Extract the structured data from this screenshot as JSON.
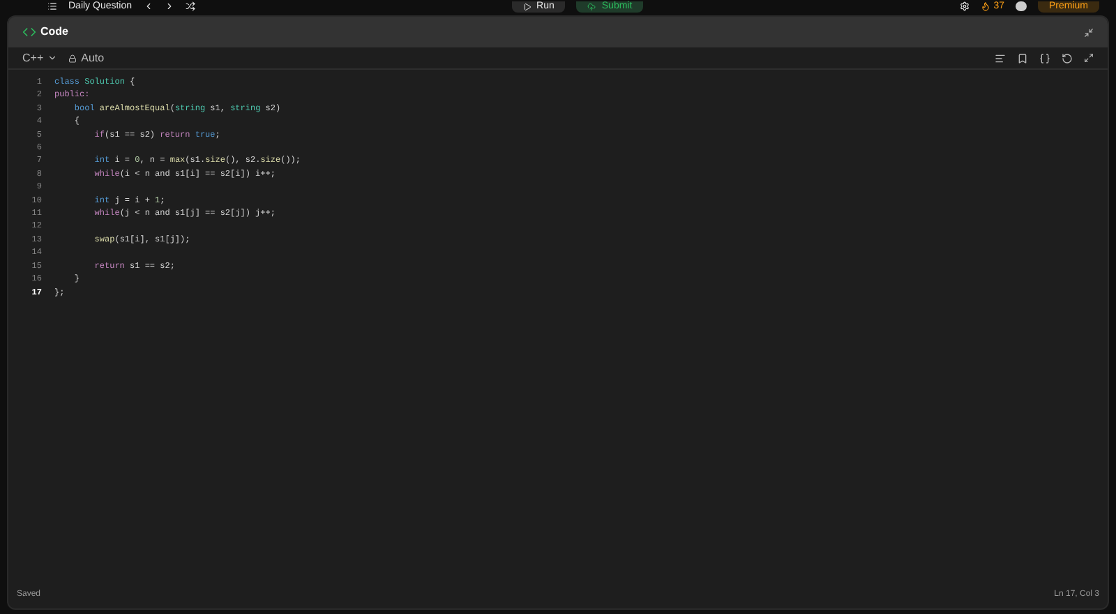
{
  "top_bar": {
    "title": "Daily Question",
    "run": "Run",
    "submit": "Submit",
    "streak": "37",
    "premium": "Premium"
  },
  "panel": {
    "title": "Code"
  },
  "toolbar": {
    "language": "C++",
    "mode": "Auto"
  },
  "editor": {
    "lines": [
      {
        "number": "1",
        "active": false,
        "tokens": [
          {
            "kind": "kw",
            "text": "class "
          },
          {
            "kind": "type",
            "text": "Solution"
          },
          {
            "kind": "plain",
            "text": " {"
          }
        ]
      },
      {
        "number": "2",
        "active": false,
        "tokens": [
          {
            "kind": "ctrl",
            "text": "public:"
          }
        ]
      },
      {
        "number": "3",
        "active": false,
        "tokens": [
          {
            "kind": "kw",
            "text": "    bool "
          },
          {
            "kind": "fn",
            "text": "areAlmostEqual"
          },
          {
            "kind": "plain",
            "text": "("
          },
          {
            "kind": "type",
            "text": "string"
          },
          {
            "kind": "plain",
            "text": " s1, "
          },
          {
            "kind": "type",
            "text": "string"
          },
          {
            "kind": "plain",
            "text": " s2)"
          }
        ]
      },
      {
        "number": "4",
        "active": false,
        "tokens": [
          {
            "kind": "plain",
            "text": "    {"
          }
        ]
      },
      {
        "number": "5",
        "active": false,
        "tokens": [
          {
            "kind": "ctrl",
            "text": "        if"
          },
          {
            "kind": "plain",
            "text": "(s1 == s2) "
          },
          {
            "kind": "ctrl",
            "text": "return "
          },
          {
            "kind": "kw",
            "text": "true"
          },
          {
            "kind": "plain",
            "text": ";"
          }
        ]
      },
      {
        "number": "6",
        "active": false
      },
      {
        "number": "7",
        "active": false,
        "tokens": [
          {
            "kind": "kw",
            "text": "        int"
          },
          {
            "kind": "plain",
            "text": " i = "
          },
          {
            "kind": "num",
            "text": "0"
          },
          {
            "kind": "plain",
            "text": ", n = "
          },
          {
            "kind": "fn",
            "text": "max"
          },
          {
            "kind": "plain",
            "text": "(s1."
          },
          {
            "kind": "fn",
            "text": "size"
          },
          {
            "kind": "plain",
            "text": "(), s2."
          },
          {
            "kind": "fn",
            "text": "size"
          },
          {
            "kind": "plain",
            "text": "());"
          }
        ]
      },
      {
        "number": "8",
        "active": false,
        "tokens": [
          {
            "kind": "ctrl",
            "text": "        while"
          },
          {
            "kind": "plain",
            "text": "(i < n and s1[i] == s2[i]) i++;"
          }
        ]
      },
      {
        "number": "9",
        "active": false
      },
      {
        "number": "10",
        "active": false,
        "tokens": [
          {
            "kind": "kw",
            "text": "        int"
          },
          {
            "kind": "plain",
            "text": " j = i + "
          },
          {
            "kind": "num",
            "text": "1"
          },
          {
            "kind": "plain",
            "text": ";"
          }
        ]
      },
      {
        "number": "11",
        "active": false,
        "tokens": [
          {
            "kind": "ctrl",
            "text": "        while"
          },
          {
            "kind": "plain",
            "text": "(j < n and s1[j] == s2[j]) j++;"
          }
        ]
      },
      {
        "number": "12",
        "active": false
      },
      {
        "number": "13",
        "active": false,
        "tokens": [
          {
            "kind": "fn",
            "text": "        swap"
          },
          {
            "kind": "plain",
            "text": "(s1[i], s1[j]);"
          }
        ]
      },
      {
        "number": "14",
        "active": false
      },
      {
        "number": "15",
        "active": false,
        "tokens": [
          {
            "kind": "ctrl",
            "text": "        return"
          },
          {
            "kind": "plain",
            "text": " s1 == s2;"
          }
        ]
      },
      {
        "number": "16",
        "active": false,
        "tokens": [
          {
            "kind": "plain",
            "text": "    }"
          }
        ]
      },
      {
        "number": "17",
        "active": true,
        "tokens": [
          {
            "kind": "plain",
            "text": "};"
          }
        ]
      }
    ]
  },
  "status_bar": {
    "left": "Saved",
    "right": "Ln 17, Col 3"
  }
}
